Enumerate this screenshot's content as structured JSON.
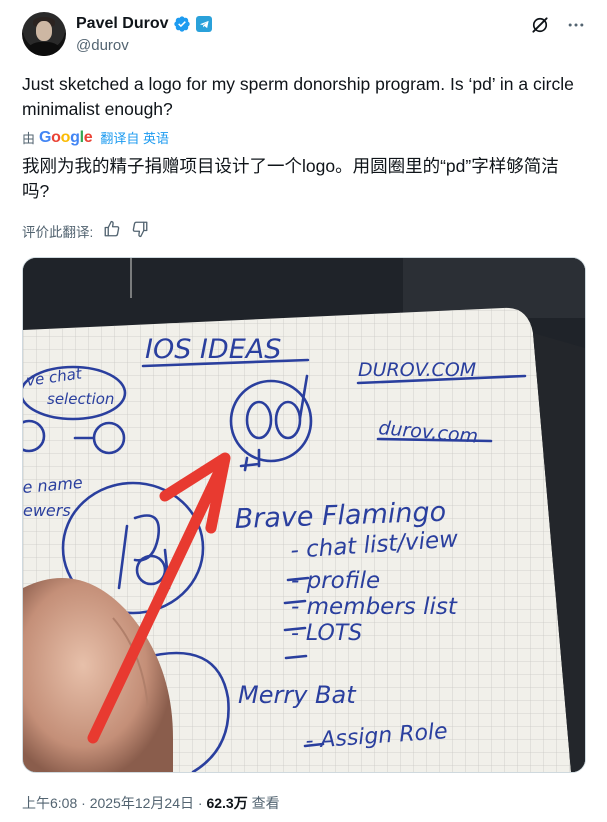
{
  "author": {
    "display_name": "Pavel Durov",
    "handle": "@durov"
  },
  "post": {
    "text": "Just sketched a logo for my sperm donorship program. Is ‘pd’ in a circle minimalist enough?"
  },
  "translation": {
    "by_label": "由",
    "google_label": "Google",
    "link_label": "翻译自 英语",
    "text": "我刚为我的精子捐赠项目设计了一个logo。用圆圈里的“pd”字样够简洁吗?",
    "rate_label": "评价此翻译:"
  },
  "media": {
    "sketch_lines": [
      "IOS IDEAS",
      "DUROV.COM",
      "durov.com",
      "Brave Flamingo",
      "- chat list/view",
      "- profile",
      "- members list",
      "- LOTS",
      "Merry Bat",
      "- Assign Role",
      "ve chat",
      "selection",
      "e name",
      "ewers"
    ]
  },
  "meta": {
    "time": "上午6:08",
    "separator": "·",
    "date": "2025年12月24日",
    "views_count": "62.3万",
    "views_label": "查看"
  },
  "colors": {
    "verified_blue": "#1d9bf0",
    "telegram_blue": "#2aa1da",
    "ink_blue": "#2a3f9e",
    "arrow_red": "#e83a30"
  },
  "icons": [
    "verified-badge-icon",
    "telegram-icon",
    "grok-icon",
    "more-icon",
    "thumbs-up-icon",
    "thumbs-down-icon"
  ]
}
